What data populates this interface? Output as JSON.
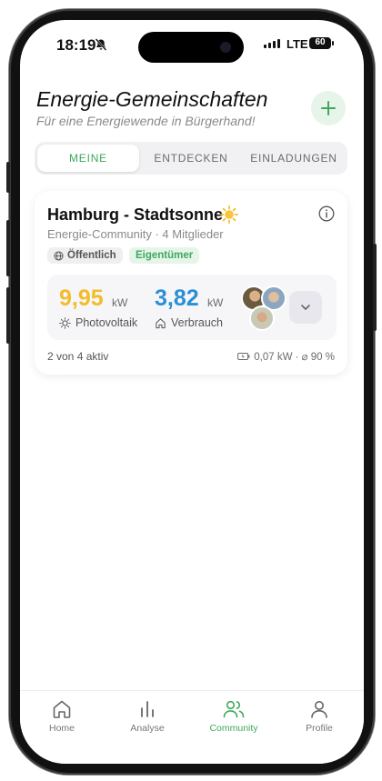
{
  "status_bar": {
    "time": "18:19",
    "network": "LTE",
    "battery": "60"
  },
  "header": {
    "title": "Energie-Gemeinschaften",
    "subtitle": "Für eine Energiewende in Bürgerhand!"
  },
  "tabs": [
    {
      "label": "MEINE",
      "active": true
    },
    {
      "label": "ENTDECKEN",
      "active": false
    },
    {
      "label": "EINLADUNGEN",
      "active": false
    }
  ],
  "community": {
    "name": "Hamburg - Stadtsonne",
    "subtitle": "Energie-Community · 4 Mitglieder",
    "badge_visibility": "Öffentlich",
    "badge_role": "Eigentümer",
    "pv_value": "9,95",
    "pv_unit": "kW",
    "pv_label": "Photovoltaik",
    "consumption_value": "3,82",
    "consumption_unit": "kW",
    "consumption_label": "Verbrauch",
    "active_members": "2 von 4 aktiv",
    "battery_stats": "0,07 kW · ⌀ 90 %"
  },
  "colors": {
    "accent_green": "#3fa85c",
    "pv_yellow": "#f2bd2c",
    "consumption_blue": "#2a8fd6"
  },
  "nav": [
    {
      "label": "Home",
      "icon": "home-icon",
      "active": false
    },
    {
      "label": "Analyse",
      "icon": "bar-chart-icon",
      "active": false
    },
    {
      "label": "Community",
      "icon": "users-icon",
      "active": true
    },
    {
      "label": "Profile",
      "icon": "user-icon",
      "active": false
    }
  ]
}
